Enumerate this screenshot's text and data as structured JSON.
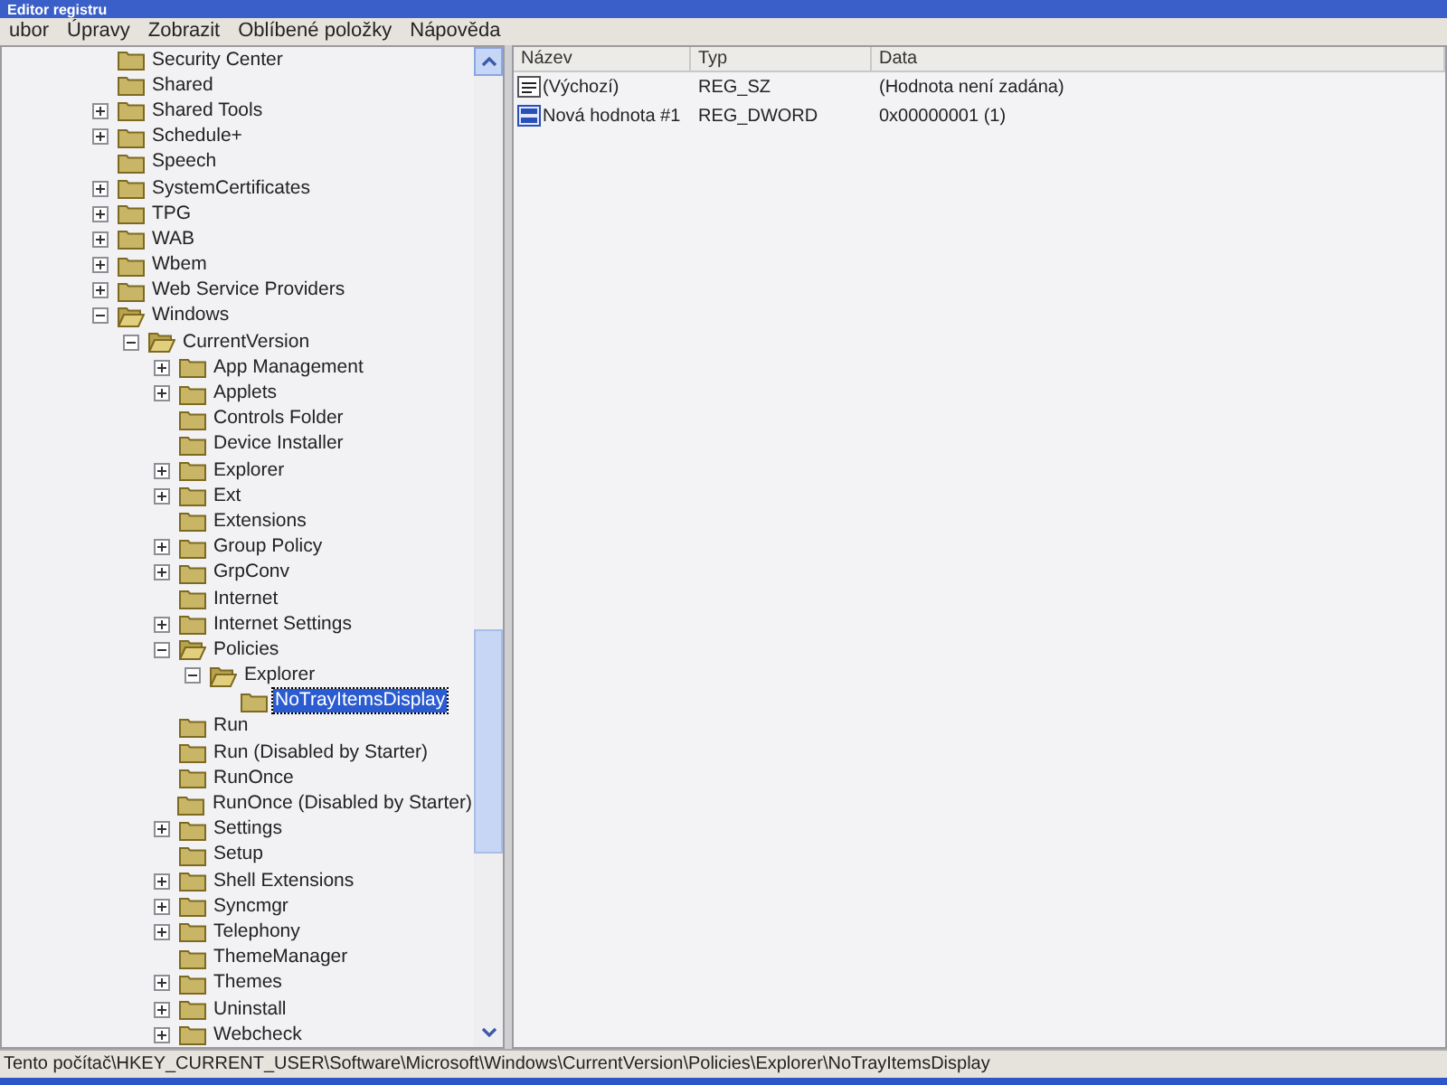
{
  "window": {
    "title": "Editor registru"
  },
  "menu": [
    "ubor",
    "Úpravy",
    "Zobrazit",
    "Oblíbené položky",
    "Nápověda"
  ],
  "tree": [
    {
      "label": "Security Center",
      "expandable": false,
      "selected": false
    },
    {
      "label": "Shared",
      "expandable": false,
      "selected": false
    },
    {
      "label": "Shared Tools",
      "expandable": true,
      "expanded": false,
      "selected": false
    },
    {
      "label": "Schedule+",
      "expandable": true,
      "expanded": false,
      "selected": false
    },
    {
      "label": "Speech",
      "expandable": false,
      "selected": false
    },
    {
      "label": "SystemCertificates",
      "expandable": true,
      "expanded": false,
      "selected": false
    },
    {
      "label": "TPG",
      "expandable": true,
      "expanded": false,
      "selected": false
    },
    {
      "label": "WAB",
      "expandable": true,
      "expanded": false,
      "selected": false
    },
    {
      "label": "Wbem",
      "expandable": true,
      "expanded": false,
      "selected": false
    },
    {
      "label": "Web Service Providers",
      "expandable": true,
      "expanded": false,
      "selected": false
    },
    {
      "label": "Windows",
      "expandable": true,
      "expanded": true,
      "selected": false,
      "children": [
        {
          "label": "CurrentVersion",
          "expandable": true,
          "expanded": true,
          "selected": false,
          "children": [
            {
              "label": "App Management",
              "expandable": true,
              "expanded": false,
              "selected": false
            },
            {
              "label": "Applets",
              "expandable": true,
              "expanded": false,
              "selected": false
            },
            {
              "label": "Controls Folder",
              "expandable": false,
              "selected": false
            },
            {
              "label": "Device Installer",
              "expandable": false,
              "selected": false
            },
            {
              "label": "Explorer",
              "expandable": true,
              "expanded": false,
              "selected": false
            },
            {
              "label": "Ext",
              "expandable": true,
              "expanded": false,
              "selected": false
            },
            {
              "label": "Extensions",
              "expandable": false,
              "selected": false
            },
            {
              "label": "Group Policy",
              "expandable": true,
              "expanded": false,
              "selected": false
            },
            {
              "label": "GrpConv",
              "expandable": true,
              "expanded": false,
              "selected": false
            },
            {
              "label": "Internet",
              "expandable": false,
              "selected": false
            },
            {
              "label": "Internet Settings",
              "expandable": true,
              "expanded": false,
              "selected": false
            },
            {
              "label": "Policies",
              "expandable": true,
              "expanded": true,
              "selected": false,
              "children": [
                {
                  "label": "Explorer",
                  "expandable": true,
                  "expanded": true,
                  "selected": false,
                  "children": [
                    {
                      "label": "NoTrayItemsDisplay",
                      "expandable": false,
                      "selected": true
                    }
                  ]
                }
              ]
            },
            {
              "label": "Run",
              "expandable": false,
              "selected": false
            },
            {
              "label": "Run (Disabled by Starter)",
              "expandable": false,
              "selected": false
            },
            {
              "label": "RunOnce",
              "expandable": false,
              "selected": false
            },
            {
              "label": "RunOnce (Disabled by Starter)",
              "expandable": false,
              "selected": false
            },
            {
              "label": "Settings",
              "expandable": true,
              "expanded": false,
              "selected": false
            },
            {
              "label": "Setup",
              "expandable": false,
              "selected": false
            },
            {
              "label": "Shell Extensions",
              "expandable": true,
              "expanded": false,
              "selected": false
            },
            {
              "label": "Syncmgr",
              "expandable": true,
              "expanded": false,
              "selected": false
            },
            {
              "label": "Telephony",
              "expandable": true,
              "expanded": false,
              "selected": false
            },
            {
              "label": "ThemeManager",
              "expandable": false,
              "selected": false
            },
            {
              "label": "Themes",
              "expandable": true,
              "expanded": false,
              "selected": false
            },
            {
              "label": "Uninstall",
              "expandable": true,
              "expanded": false,
              "selected": false
            },
            {
              "label": "Webcheck",
              "expandable": true,
              "expanded": false,
              "selected": false
            }
          ]
        }
      ]
    }
  ],
  "values": {
    "columns": [
      "Název",
      "Typ",
      "Data"
    ],
    "rows": [
      {
        "kind": "string",
        "name": "(Výchozí)",
        "type": "REG_SZ",
        "data": "(Hodnota není zadána)"
      },
      {
        "kind": "binary",
        "name": "Nová hodnota #1",
        "type": "REG_DWORD",
        "data": "0x00000001 (1)"
      }
    ]
  },
  "status_bar": "Tento počítač\\HKEY_CURRENT_USER\\Software\\Microsoft\\Windows\\CurrentVersion\\Policies\\Explorer\\NoTrayItemsDisplay"
}
